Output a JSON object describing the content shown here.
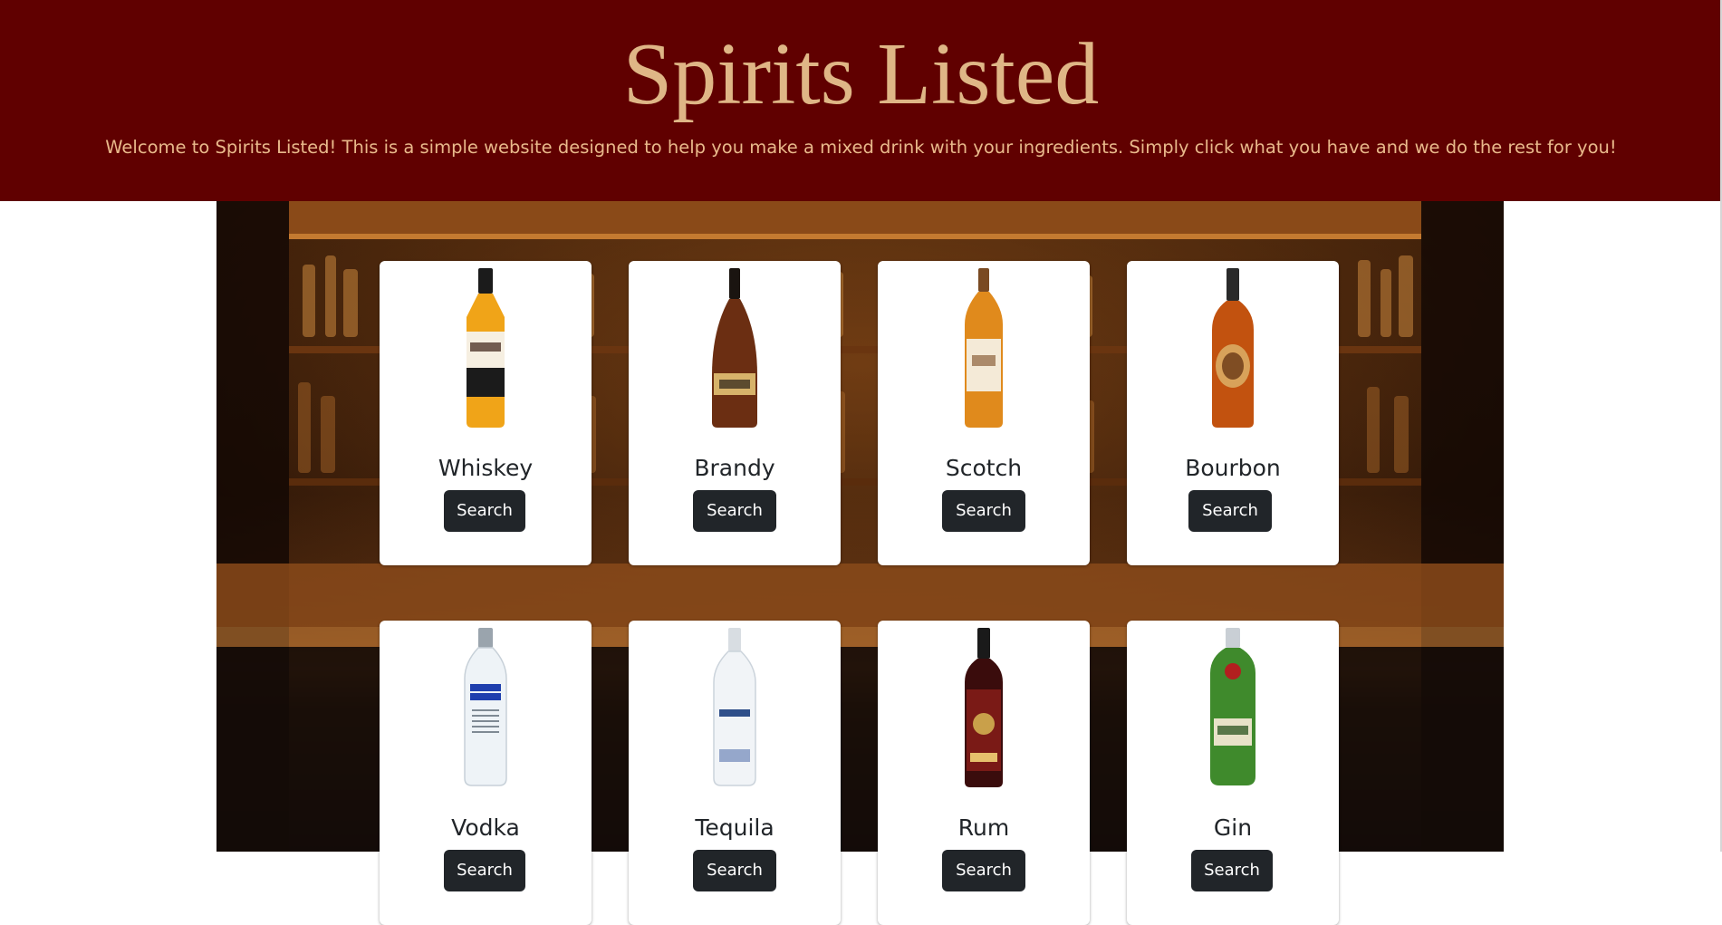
{
  "header": {
    "title": "Spirits Listed",
    "welcome": "Welcome to Spirits Listed! This is a simple website designed to help you make a mixed drink with your ingredients. Simply click what you have and we do the rest for you!"
  },
  "colors": {
    "header_bg": "#600000",
    "title": "#dfb686",
    "button_bg": "#212529",
    "button_text": "#ffffff"
  },
  "spirits": [
    {
      "name": "Whiskey",
      "button": "Search",
      "image": "whiskey-bottle-image"
    },
    {
      "name": "Brandy",
      "button": "Search",
      "image": "brandy-bottle-image"
    },
    {
      "name": "Scotch",
      "button": "Search",
      "image": "scotch-bottle-image"
    },
    {
      "name": "Bourbon",
      "button": "Search",
      "image": "bourbon-bottle-image"
    },
    {
      "name": "Vodka",
      "button": "Search",
      "image": "vodka-bottle-image"
    },
    {
      "name": "Tequila",
      "button": "Search",
      "image": "tequila-bottle-image"
    },
    {
      "name": "Rum",
      "button": "Search",
      "image": "rum-bottle-image"
    },
    {
      "name": "Gin",
      "button": "Search",
      "image": "gin-bottle-image"
    }
  ]
}
